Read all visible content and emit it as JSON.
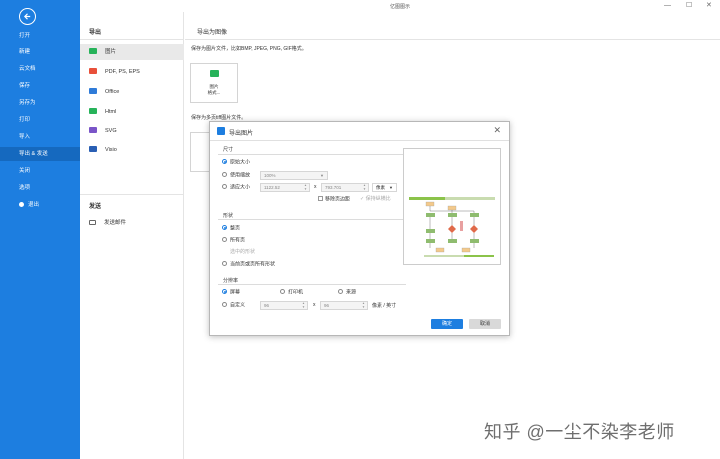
{
  "window": {
    "title": "亿图图示",
    "minimize": "—",
    "maximize": "☐",
    "close": "✕"
  },
  "sidebar": {
    "back": "back",
    "items": [
      {
        "label": "打开"
      },
      {
        "label": "新建"
      },
      {
        "label": "云文档"
      },
      {
        "label": "保存"
      },
      {
        "label": "另存为"
      },
      {
        "label": "打印"
      },
      {
        "label": "导入"
      },
      {
        "label": "导出 & 发送",
        "active": true
      },
      {
        "label": "关闭"
      },
      {
        "label": "选项"
      },
      {
        "label": "退出"
      }
    ]
  },
  "export_panel": {
    "export_header": "导出",
    "formats": [
      {
        "label": "图片",
        "icon": "image-icon",
        "color": "#27b35a",
        "active": true
      },
      {
        "label": "PDF, PS, EPS",
        "icon": "pdf-icon",
        "color": "#e8503a"
      },
      {
        "label": "Office",
        "icon": "office-icon",
        "color": "#2f7bd8"
      },
      {
        "label": "Html",
        "icon": "html-icon",
        "color": "#27b35a"
      },
      {
        "label": "SVG",
        "icon": "svg-icon",
        "color": "#7a55c8"
      },
      {
        "label": "Visio",
        "icon": "visio-icon",
        "color": "#2a5fb4"
      }
    ],
    "send_header": "发送",
    "send_email": "发送邮件"
  },
  "content": {
    "title": "导出为图像",
    "desc1": "保存为图片文件，比如BMP, JPEG, PNG, GIF格式。",
    "card_label_1": "图片",
    "card_label_2": "格式...",
    "desc2": "保存为多页tiff图片文件。"
  },
  "dialog": {
    "title": "导出图片",
    "size_group": "尺寸",
    "size_opt1": "原始大小",
    "size_opt2": "使用缩放",
    "zoom_value": "100%",
    "size_opt3": "适应大小",
    "width_value": "1122.52",
    "times": "x",
    "height_value": "793.701",
    "unit": "像素",
    "remove_bg": "移除页边距",
    "keep_ratio": "保持纵横比",
    "shape_group": "形状",
    "shape_opt1": "整页",
    "shape_opt2": "所有页",
    "shape_opt3": "选中的形状",
    "shape_opt4": "当前页或页所有形状",
    "res_group": "分辨率",
    "res_screen": "屏幕",
    "res_printer": "打印机",
    "res_source": "来源",
    "res_custom": "自定义",
    "dpi_x": "96",
    "dpi_y": "96",
    "dpi_unit": "像素 / 英寸",
    "ok": "确定",
    "cancel": "取消"
  },
  "watermark": "知乎 @一尘不染李老师"
}
